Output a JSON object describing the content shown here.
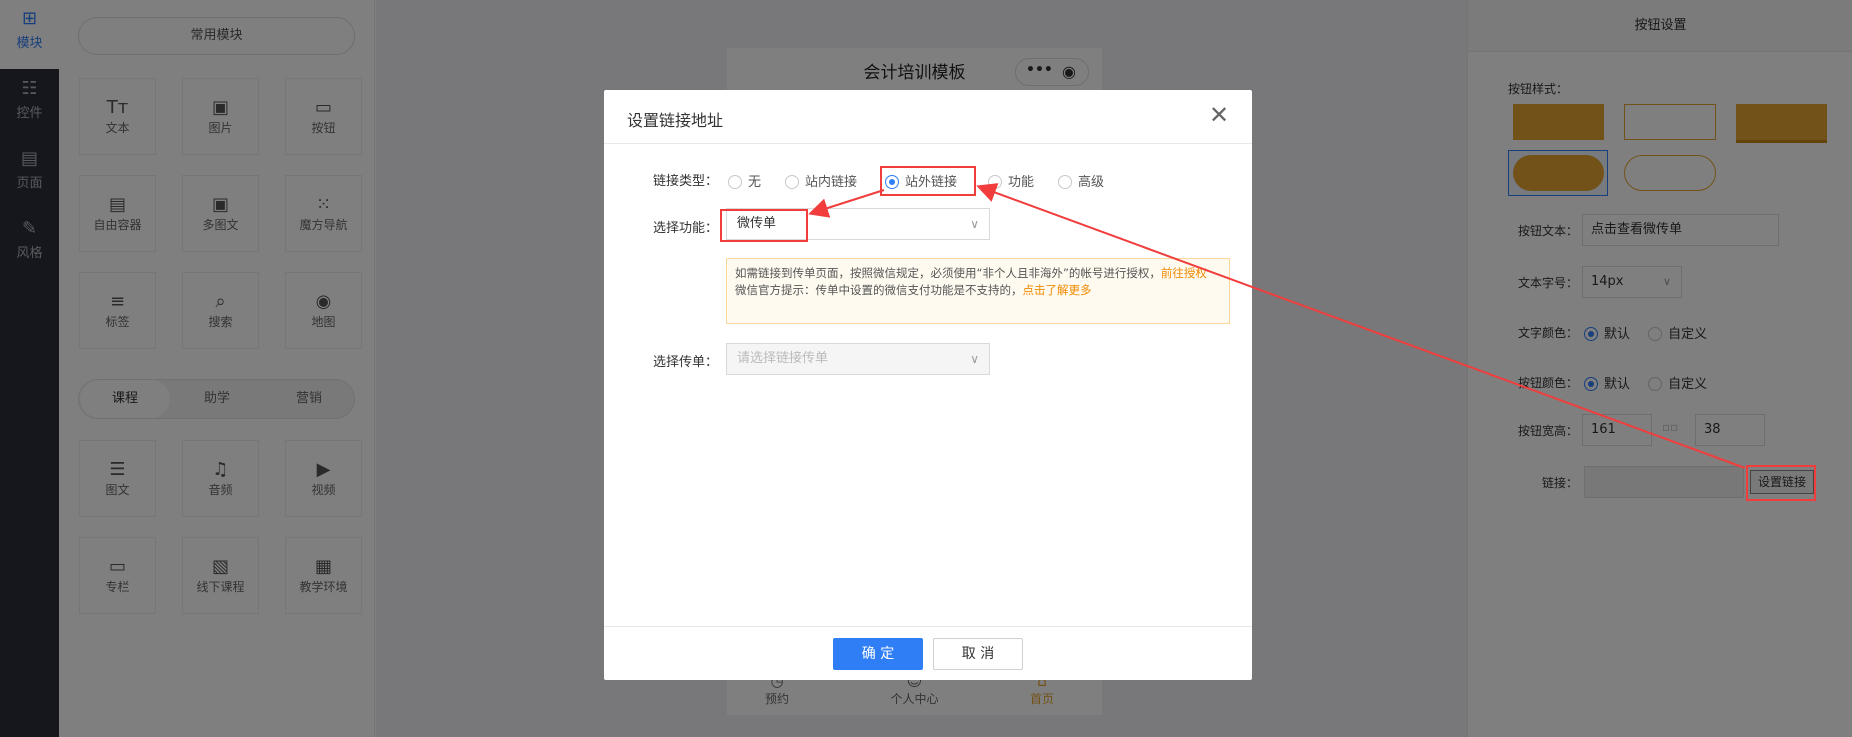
{
  "rail": {
    "items": [
      {
        "label": "模块",
        "icon": "plus-square-icon"
      },
      {
        "label": "控件",
        "icon": "sliders-icon"
      },
      {
        "label": "页面",
        "icon": "layout-icon"
      },
      {
        "label": "风格",
        "icon": "brush-icon"
      }
    ]
  },
  "components": {
    "common_label": "常用模块",
    "common": [
      {
        "label": "文本",
        "icon": "text-icon"
      },
      {
        "label": "图片",
        "icon": "image-icon"
      },
      {
        "label": "按钮",
        "icon": "button-icon"
      },
      {
        "label": "自由容器",
        "icon": "container-icon"
      },
      {
        "label": "多图文",
        "icon": "multi-image-icon"
      },
      {
        "label": "魔方导航",
        "icon": "grid-dots-icon"
      },
      {
        "label": "标签",
        "icon": "tag-icon"
      },
      {
        "label": "搜索",
        "icon": "search-icon"
      },
      {
        "label": "地图",
        "icon": "map-pin-icon"
      }
    ],
    "tabs": [
      "课程",
      "助学",
      "营销"
    ],
    "course": [
      {
        "label": "图文",
        "icon": "article-icon"
      },
      {
        "label": "音频",
        "icon": "audio-icon"
      },
      {
        "label": "视频",
        "icon": "video-icon"
      },
      {
        "label": "专栏",
        "icon": "folder-icon"
      },
      {
        "label": "线下课程",
        "icon": "offline-course-icon"
      },
      {
        "label": "教学环境",
        "icon": "environment-icon"
      }
    ]
  },
  "phone": {
    "title": "会计培训模板",
    "tabbar": [
      "预约",
      "个人中心",
      "首页"
    ]
  },
  "right_panel": {
    "title": "按钮设置",
    "style_label": "按钮样式：",
    "text_label": "按钮文本：",
    "text_value": "点击查看微传单",
    "fontsize_label": "文本字号：",
    "fontsize_value": "14px",
    "textcolor_label": "文字颜色：",
    "btncolor_label": "按钮颜色：",
    "color_options": [
      "默认",
      "自定义"
    ],
    "size_label": "按钮宽高：",
    "width_value": "161",
    "height_value": "38",
    "link_label": "链接：",
    "link_value": "",
    "set_link_button": "设置链接",
    "accent": "#e6a532"
  },
  "modal": {
    "title": "设置链接地址",
    "link_type_label": "链接类型：",
    "link_types": [
      "无",
      "站内链接",
      "站外链接",
      "功能",
      "高级"
    ],
    "selected_type": "站外链接",
    "func_label": "选择功能：",
    "func_value": "微传单",
    "notice_line1": "如需链接到传单页面，按照微信规定，必须使用“非个人且非海外”的帐号进行授权，",
    "notice_link1": "前往授权",
    "notice_line2": "微信官方提示：传单中设置的微信支付功能是不支持的，",
    "notice_link2": "点击了解更多",
    "flyer_label": "选择传单：",
    "flyer_placeholder": "请选择链接传单",
    "ok": "确 定",
    "cancel": "取 消",
    "close_icon": "close-icon"
  },
  "colors": {
    "primary": "#2f7ef6",
    "annotation": "#f23d3d",
    "warning_link": "#f08a00"
  }
}
